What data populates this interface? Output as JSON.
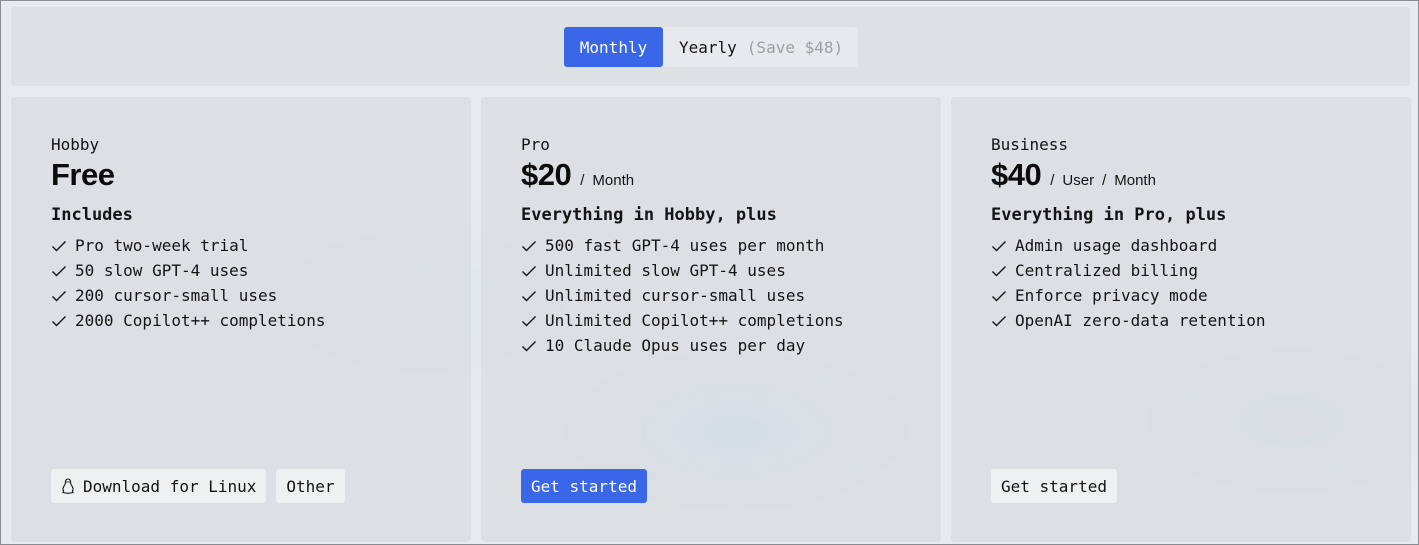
{
  "billing_toggle": {
    "monthly_label": "Monthly",
    "yearly_label": "Yearly",
    "yearly_save": "(Save $48)",
    "selected": "Monthly"
  },
  "plans": [
    {
      "name": "Hobby",
      "price": "Free",
      "includes_heading": "Includes",
      "features": [
        "Pro two-week trial",
        "50 slow GPT-4 uses",
        "200 cursor-small uses",
        "2000 Copilot++ completions"
      ],
      "buttons": {
        "download": "Download for Linux",
        "other": "Other"
      }
    },
    {
      "name": "Pro",
      "price": "$20",
      "period": [
        "Month"
      ],
      "includes_heading": "Everything in Hobby, plus",
      "features": [
        "500 fast GPT-4 uses per month",
        "Unlimited slow GPT-4 uses",
        "Unlimited cursor-small uses",
        "Unlimited Copilot++ completions",
        "10 Claude Opus uses per day"
      ],
      "buttons": {
        "cta": "Get started"
      }
    },
    {
      "name": "Business",
      "price": "$40",
      "period": [
        "User",
        "Month"
      ],
      "includes_heading": "Everything in Pro, plus",
      "features": [
        "Admin usage dashboard",
        "Centralized billing",
        "Enforce privacy mode",
        "OpenAI zero-data retention"
      ],
      "buttons": {
        "cta": "Get started"
      }
    }
  ],
  "separator": "/",
  "colors": {
    "accent": "#3a66e8",
    "card_bg": "#dcdfe2",
    "muted": "#9aa0a6"
  },
  "icons": {
    "feature": "check-icon",
    "download": "linux-icon"
  }
}
